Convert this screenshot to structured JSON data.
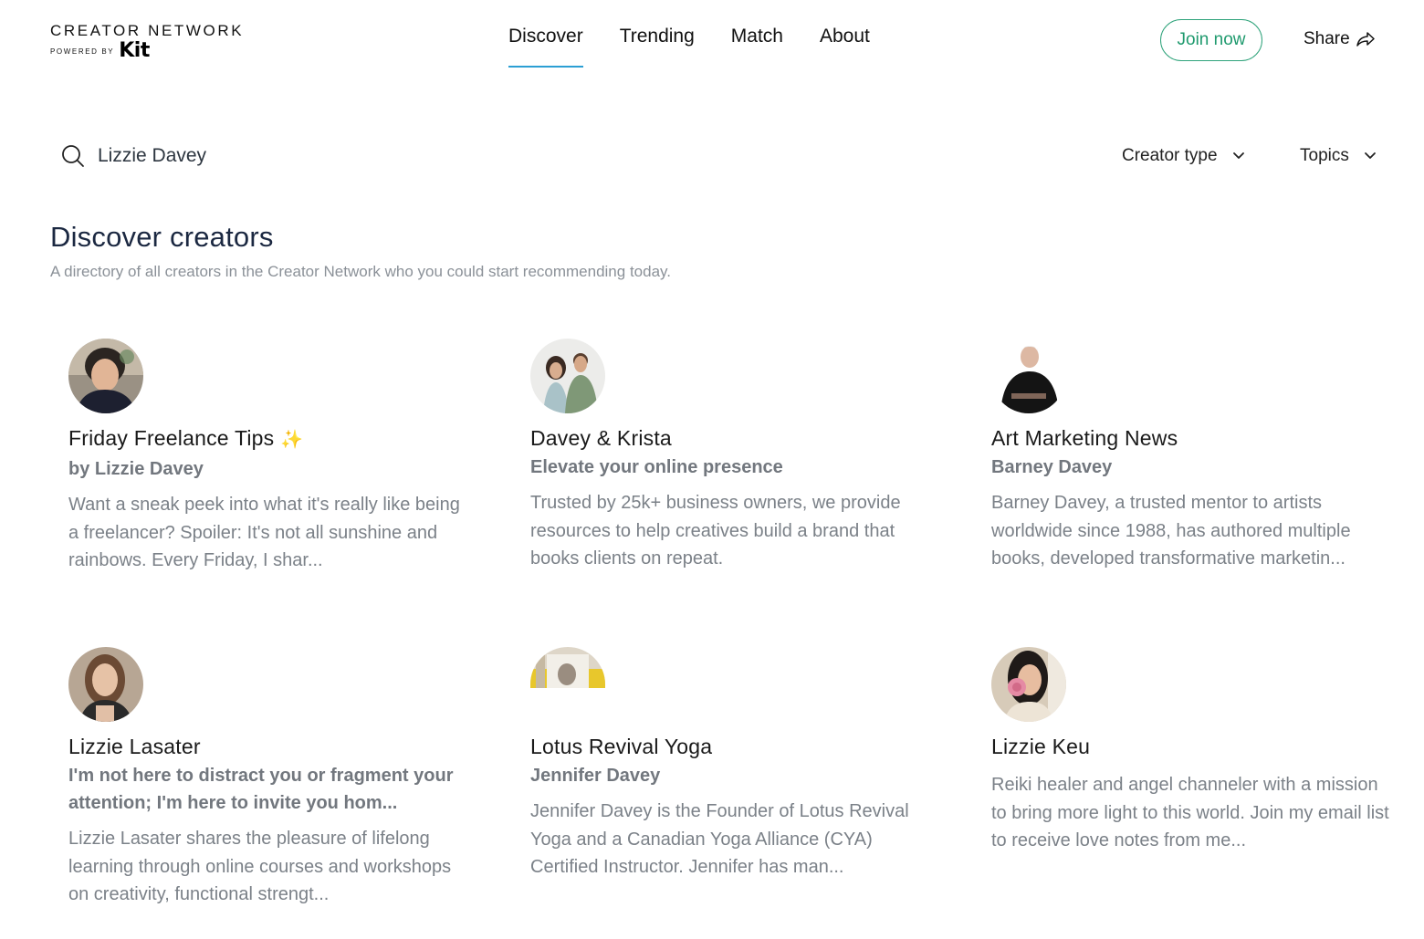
{
  "brand": {
    "title": "CREATOR NETWORK",
    "powered_by": "POWERED BY",
    "logo_text": "Kit"
  },
  "nav": {
    "items": [
      "Discover",
      "Trending",
      "Match",
      "About"
    ],
    "active": "Discover"
  },
  "header": {
    "join_label": "Join now",
    "share_label": "Share",
    "accent_color": "#2fa37b",
    "active_underline_color": "#2b9fd4"
  },
  "search": {
    "value": "Lizzie Davey",
    "icon": "search-icon"
  },
  "filters": {
    "creator_type": "Creator type",
    "topics": "Topics"
  },
  "page": {
    "title": "Discover creators",
    "subtitle": "A directory of all creators in the Creator Network who you could start recommending today."
  },
  "creators": [
    {
      "name": "Friday Freelance Tips",
      "name_suffix": "✨",
      "byline": "by Lizzie Davey",
      "description": "Want a sneak peek into what it's really like being a freelancer? Spoiler: It's not all sunshine and rainbows. Every Friday, I shar..."
    },
    {
      "name": "Davey & Krista",
      "byline": "Elevate your online presence",
      "description": "Trusted by 25k+ business owners, we provide resources to help creatives build a brand that books clients on repeat."
    },
    {
      "name": "Art Marketing News",
      "byline": "Barney Davey",
      "description": "Barney Davey, a trusted mentor to artists worldwide since 1988, has authored multiple books, developed transformative marketin..."
    },
    {
      "name": "Lizzie Lasater",
      "byline": "I'm not here to distract you or fragment your attention; I'm here to invite you hom...",
      "description": "Lizzie Lasater shares the pleasure of lifelong learning through online courses and workshops on creativity, functional strengt..."
    },
    {
      "name": "Lotus Revival Yoga",
      "byline": "Jennifer Davey",
      "description": "Jennifer Davey is the Founder of Lotus Revival Yoga and a Canadian Yoga Alliance (CYA) Certified Instructor. Jennifer has man..."
    },
    {
      "name": "Lizzie Keu",
      "byline": "",
      "description": "Reiki healer and angel channeler with a mission to bring more light to this world. Join my email list to receive love notes from me..."
    }
  ]
}
